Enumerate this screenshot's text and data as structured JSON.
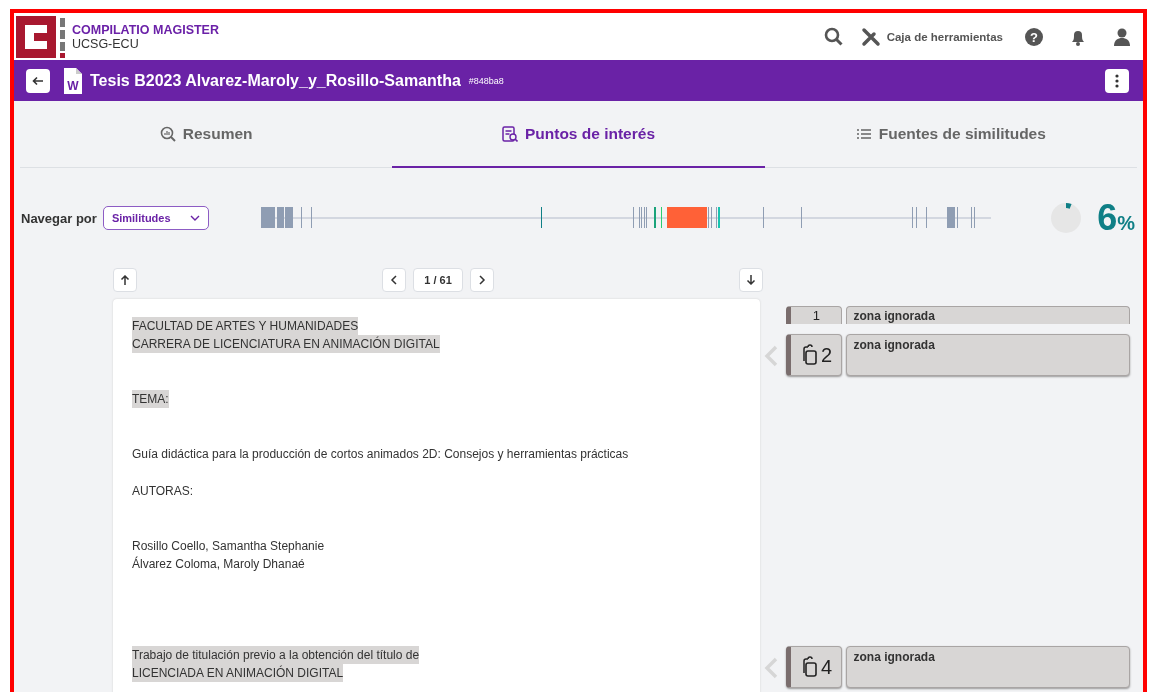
{
  "header": {
    "product": "COMPILATIO MAGISTER",
    "organization": "UCSG-ECU",
    "toolbox": "Caja de herramientas",
    "help_icon": "?"
  },
  "document": {
    "title": "Tesis B2023 Alvarez-Maroly_y_Rosillo-Samantha",
    "id": "#848ba8",
    "file_type_letter": "W"
  },
  "tabs": [
    {
      "label": "Resumen",
      "selected": false
    },
    {
      "label": "Puntos de interés",
      "selected": true
    },
    {
      "label": "Fuentes de similitudes",
      "selected": false
    }
  ],
  "navigation": {
    "label": "Navegar por",
    "dropdown": "Similitudes",
    "score": "6",
    "score_unit": "%",
    "level": 0.06
  },
  "pager": {
    "page": "1 / 61"
  },
  "text_blocks": [
    {
      "highlighted": true,
      "lines": [
        "FACULTAD DE ARTES Y HUMANIDADES",
        "CARRERA DE LICENCIATURA EN ANIMACIÓN DIGITAL"
      ]
    },
    {
      "highlighted": true,
      "lines": [
        "TEMA:"
      ]
    },
    {
      "highlighted": false,
      "lines": [
        "Guía didáctica para la producción de cortos animados 2D: Consejos y herramientas prácticas"
      ]
    },
    {
      "highlighted": false,
      "lines": [
        "AUTORAS:"
      ]
    },
    {
      "highlighted": false,
      "lines": [
        "Rosillo Coello, Samantha Stephanie",
        "Álvarez Coloma, Maroly Dhanaé"
      ]
    },
    {
      "highlighted": true,
      "lines": [
        "Trabajo de titulación previo a la obtención del título de",
        "LICENCIADA EN ANIMACIÓN DIGITAL"
      ]
    }
  ],
  "match_cards": [
    {
      "number": "1",
      "label": "zona ignorada"
    },
    {
      "number": "2",
      "label": "zona ignorada"
    },
    {
      "number": "4",
      "label": "zona ignorada"
    }
  ]
}
